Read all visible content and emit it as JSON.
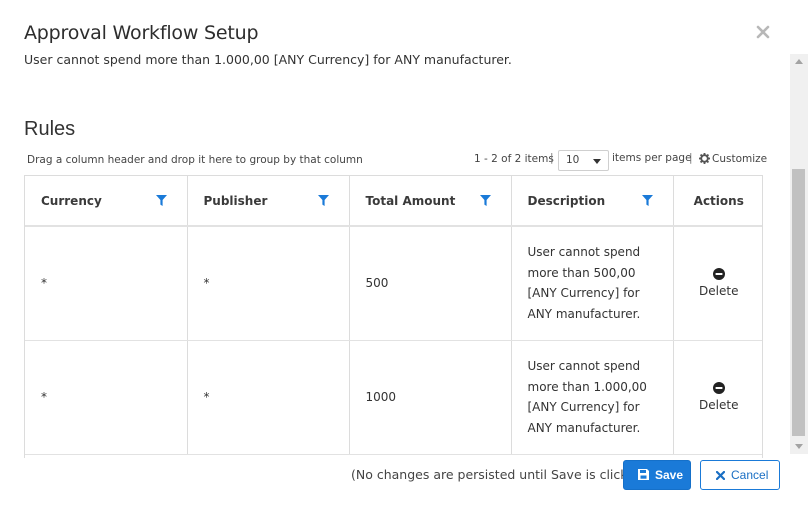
{
  "dialog": {
    "title": "Approval Workflow Setup",
    "subtitle": "User cannot spend more than 1.000,00 [ANY Currency] for ANY manufacturer.",
    "close_icon": "close-icon"
  },
  "rules": {
    "heading": "Rules",
    "group_hint": "Drag a column header and drop it here to group by that column",
    "pager": {
      "range": "1 - 2 of 2 items",
      "separator": "|",
      "page_size": "10",
      "items_per_page": "items per page",
      "customize": "Customize"
    },
    "columns": [
      {
        "label": "Currency",
        "filterable": true
      },
      {
        "label": "Publisher",
        "filterable": true
      },
      {
        "label": "Total Amount",
        "filterable": true
      },
      {
        "label": "Description",
        "filterable": true
      },
      {
        "label": "Actions",
        "filterable": false
      }
    ],
    "rows": [
      {
        "currency": "*",
        "publisher": "*",
        "total_amount": "500",
        "description_lines": [
          "User cannot spend",
          "more than 500,00",
          "[ANY Currency] for",
          "ANY manufacturer."
        ],
        "action": "Delete"
      },
      {
        "currency": "*",
        "publisher": "*",
        "total_amount": "1000",
        "description_lines": [
          "User cannot spend",
          "more than 1.000,00",
          "[ANY Currency] for",
          "ANY manufacturer."
        ],
        "action": "Delete"
      }
    ]
  },
  "footer": {
    "note": "(No changes are persisted until Save is clicked)",
    "save_label": "Save",
    "cancel_label": "Cancel"
  },
  "colors": {
    "primary": "#1a7ad8",
    "filter_icon": "#1a7ad8",
    "border": "#dcdcdc"
  }
}
